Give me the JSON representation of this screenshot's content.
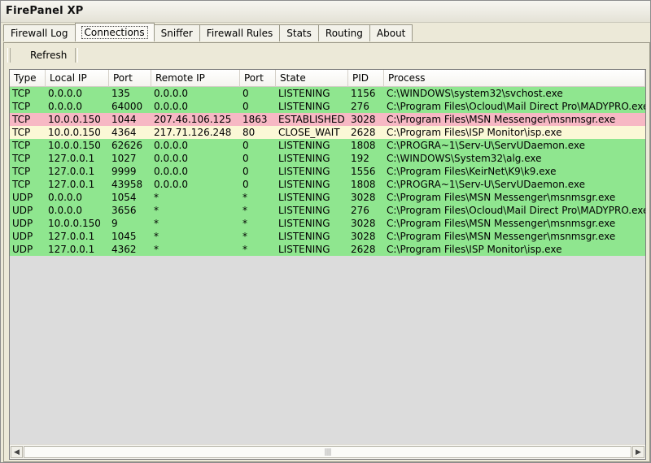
{
  "window": {
    "title": "FirePanel XP"
  },
  "tabs": [
    {
      "label": "Firewall Log"
    },
    {
      "label": "Connections"
    },
    {
      "label": "Sniffer"
    },
    {
      "label": "Firewall Rules"
    },
    {
      "label": "Stats"
    },
    {
      "label": "Routing"
    },
    {
      "label": "About"
    }
  ],
  "toolbar": {
    "refresh_label": "Refresh"
  },
  "colors": {
    "listening": "#8fe68f",
    "established": "#f7b8c4",
    "close_wait": "#fbf8d6",
    "list_background": "#dcdcdc"
  },
  "columns": [
    "Type",
    "Local IP",
    "Port",
    "Remote IP",
    "Port",
    "State",
    "PID",
    "Process"
  ],
  "rows": [
    {
      "type": "TCP",
      "local_ip": "0.0.0.0",
      "local_port": "135",
      "remote_ip": "0.0.0.0",
      "remote_port": "0",
      "state": "LISTENING",
      "pid": "1156",
      "process": "C:\\WINDOWS\\system32\\svchost.exe"
    },
    {
      "type": "TCP",
      "local_ip": "0.0.0.0",
      "local_port": "64000",
      "remote_ip": "0.0.0.0",
      "remote_port": "0",
      "state": "LISTENING",
      "pid": "276",
      "process": "C:\\Program Files\\Ocloud\\Mail Direct Pro\\MADYPRO.exe"
    },
    {
      "type": "TCP",
      "local_ip": "10.0.0.150",
      "local_port": "1044",
      "remote_ip": "207.46.106.125",
      "remote_port": "1863",
      "state": "ESTABLISHED",
      "pid": "3028",
      "process": "C:\\Program Files\\MSN Messenger\\msnmsgr.exe"
    },
    {
      "type": "TCP",
      "local_ip": "10.0.0.150",
      "local_port": "4364",
      "remote_ip": "217.71.126.248",
      "remote_port": "80",
      "state": "CLOSE_WAIT",
      "pid": "2628",
      "process": "C:\\Program Files\\ISP Monitor\\isp.exe"
    },
    {
      "type": "TCP",
      "local_ip": "10.0.0.150",
      "local_port": "62626",
      "remote_ip": "0.0.0.0",
      "remote_port": "0",
      "state": "LISTENING",
      "pid": "1808",
      "process": "C:\\PROGRA~1\\Serv-U\\ServUDaemon.exe"
    },
    {
      "type": "TCP",
      "local_ip": "127.0.0.1",
      "local_port": "1027",
      "remote_ip": "0.0.0.0",
      "remote_port": "0",
      "state": "LISTENING",
      "pid": "192",
      "process": "C:\\WINDOWS\\System32\\alg.exe"
    },
    {
      "type": "TCP",
      "local_ip": "127.0.0.1",
      "local_port": "9999",
      "remote_ip": "0.0.0.0",
      "remote_port": "0",
      "state": "LISTENING",
      "pid": "1556",
      "process": "C:\\Program Files\\KeirNet\\K9\\k9.exe"
    },
    {
      "type": "TCP",
      "local_ip": "127.0.0.1",
      "local_port": "43958",
      "remote_ip": "0.0.0.0",
      "remote_port": "0",
      "state": "LISTENING",
      "pid": "1808",
      "process": "C:\\PROGRA~1\\Serv-U\\ServUDaemon.exe"
    },
    {
      "type": "UDP",
      "local_ip": "0.0.0.0",
      "local_port": "1054",
      "remote_ip": "*",
      "remote_port": "*",
      "state": "LISTENING",
      "pid": "3028",
      "process": "C:\\Program Files\\MSN Messenger\\msnmsgr.exe"
    },
    {
      "type": "UDP",
      "local_ip": "0.0.0.0",
      "local_port": "3656",
      "remote_ip": "*",
      "remote_port": "*",
      "state": "LISTENING",
      "pid": "276",
      "process": "C:\\Program Files\\Ocloud\\Mail Direct Pro\\MADYPRO.exe"
    },
    {
      "type": "UDP",
      "local_ip": "10.0.0.150",
      "local_port": "9",
      "remote_ip": "*",
      "remote_port": "*",
      "state": "LISTENING",
      "pid": "3028",
      "process": "C:\\Program Files\\MSN Messenger\\msnmsgr.exe"
    },
    {
      "type": "UDP",
      "local_ip": "127.0.0.1",
      "local_port": "1045",
      "remote_ip": "*",
      "remote_port": "*",
      "state": "LISTENING",
      "pid": "3028",
      "process": "C:\\Program Files\\MSN Messenger\\msnmsgr.exe"
    },
    {
      "type": "UDP",
      "local_ip": "127.0.0.1",
      "local_port": "4362",
      "remote_ip": "*",
      "remote_port": "*",
      "state": "LISTENING",
      "pid": "2628",
      "process": "C:\\Program Files\\ISP Monitor\\isp.exe"
    }
  ],
  "scrollbar": {
    "left_arrow_icon": "left-arrow-icon",
    "right_arrow_icon": "right-arrow-icon"
  }
}
